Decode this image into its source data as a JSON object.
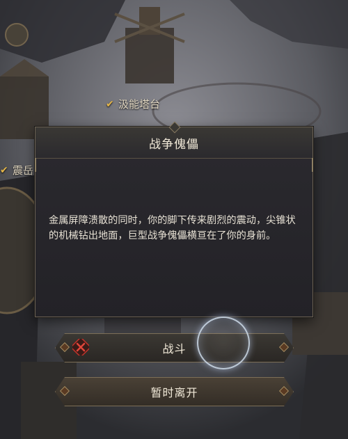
{
  "map_labels": [
    {
      "text": "汲能塔台"
    },
    {
      "text": "震岳"
    }
  ],
  "dialog": {
    "title": "战争傀儡",
    "body": "金属屏障溃散的同时，你的脚下传来剧烈的震动，尖锥状的机械钻出地面，巨型战争傀儡横亘在了你的身前。"
  },
  "buttons": {
    "fight": "战斗",
    "leave": "暂时离开"
  },
  "icons": {
    "check": "checkmark-icon",
    "fight": "crossed-swords-icon"
  },
  "colors": {
    "accent_gold": "#e4b64a",
    "fight_icon_red": "#c0322a",
    "panel_bg": "#2b2a2f"
  }
}
